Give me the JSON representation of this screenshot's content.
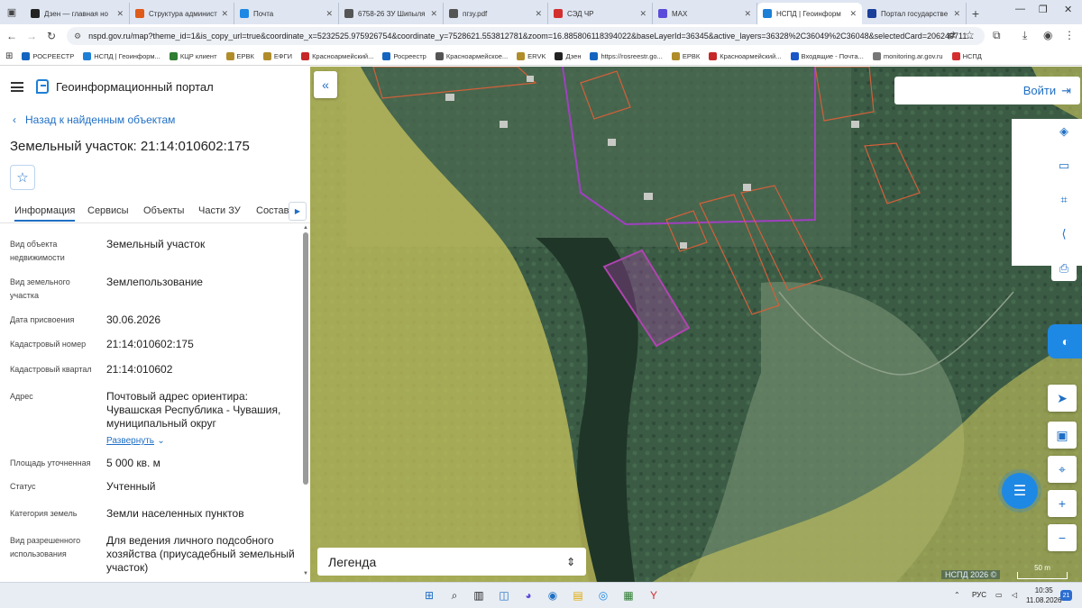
{
  "browser": {
    "tabs": [
      {
        "label": "Дзен — главная но",
        "color": "#222222",
        "active": false
      },
      {
        "label": "Структура админист",
        "color": "#e05a1a",
        "active": false
      },
      {
        "label": "Почта",
        "color": "#1e88e5",
        "active": false
      },
      {
        "label": "6758-26 ЗУ Шипыля",
        "color": "#555555",
        "active": false
      },
      {
        "label": "пгзу.pdf",
        "color": "#555555",
        "active": false
      },
      {
        "label": "СЭД ЧР",
        "color": "#d32f2f",
        "active": false
      },
      {
        "label": "MAX",
        "color": "#5b4bdb",
        "active": false
      },
      {
        "label": "НСПД | Геоинформ",
        "color": "#1e7fd6",
        "active": true
      },
      {
        "label": "Портал государстве",
        "color": "#1a3f9a",
        "active": false
      }
    ],
    "url": "nspd.gov.ru/map?theme_id=1&is_copy_url=true&coordinate_x=5232525.975926754&coordinate_y=7528621.553812781&zoom=16.885806118394022&baseLayerId=36345&active_layers=36328%2C36049%2C36048&selectedCard=206249711...",
    "bookmarks": [
      {
        "label": "РОСРЕЕСТР",
        "color": "#1565c0"
      },
      {
        "label": "НСПД | Геоинформ...",
        "color": "#1e7fd6"
      },
      {
        "label": "КЦР клиент",
        "color": "#2e7d32"
      },
      {
        "label": "ЕРВК",
        "color": "#b08d2a"
      },
      {
        "label": "ЕФГИ",
        "color": "#b08d2a"
      },
      {
        "label": "Красноармейский...",
        "color": "#c62828"
      },
      {
        "label": "Росреестр",
        "color": "#1565c0"
      },
      {
        "label": "Красноармейское...",
        "color": "#555555"
      },
      {
        "label": "ERVK",
        "color": "#b08d2a"
      },
      {
        "label": "Дзен",
        "color": "#222222"
      },
      {
        "label": "https://rosreestr.go...",
        "color": "#1565c0"
      },
      {
        "label": "ЕРВК",
        "color": "#b08d2a"
      },
      {
        "label": "Красноармейский...",
        "color": "#c62828"
      },
      {
        "label": "Входящие - Почта...",
        "color": "#1a56c7"
      },
      {
        "label": "monitoring.ar.gov.ru",
        "color": "#777777"
      },
      {
        "label": "НСПД",
        "color": "#d32f2f"
      }
    ]
  },
  "header": {
    "portal_title": "Геоинформационный портал"
  },
  "panel": {
    "back_label": "Назад к найденным объектам",
    "title": "Земельный участок: 21:14:010602:175",
    "tabs": [
      "Информация",
      "Сервисы",
      "Объекты",
      "Части ЗУ",
      "Состав"
    ],
    "rows": [
      {
        "label": "Вид объекта недвижимости",
        "value": "Земельный участок"
      },
      {
        "label": "Вид земельного участка",
        "value": "Землепользование"
      },
      {
        "label": "Дата присвоения",
        "value": "30.06.2026"
      },
      {
        "label": "Кадастровый номер",
        "value": "21:14:010602:175"
      },
      {
        "label": "Кадастровый квартал",
        "value": "21:14:010602"
      },
      {
        "label": "Адрес",
        "value": "Почтовый адрес ориентира: Чувашская Республика - Чувашия, муниципальный округ"
      },
      {
        "label": "Площадь уточненная",
        "value": "5 000 кв. м"
      },
      {
        "label": "Статус",
        "value": "Учтенный"
      },
      {
        "label": "Категория земель",
        "value": "Земли населенных пунктов"
      },
      {
        "label": "Вид разрешенного использования",
        "value": "Для ведения личного подсобного хозяйства (приусадебный земельный участок)"
      }
    ],
    "expand_label": "Развернуть"
  },
  "map": {
    "login_label": "Войти",
    "legend_label": "Легенда",
    "copyright": "НСПД 2026 ©",
    "scale_label": "50 m",
    "colors": {
      "yellow_zone": "#d4cf6a",
      "selected_parcel": "#b044b0",
      "parcel_outline": "#d2603a",
      "boundary": "#a040c0"
    }
  },
  "taskbar": {
    "lang": "РУС",
    "time": "10:35",
    "date": "11.08.2026",
    "notifications": "21"
  }
}
